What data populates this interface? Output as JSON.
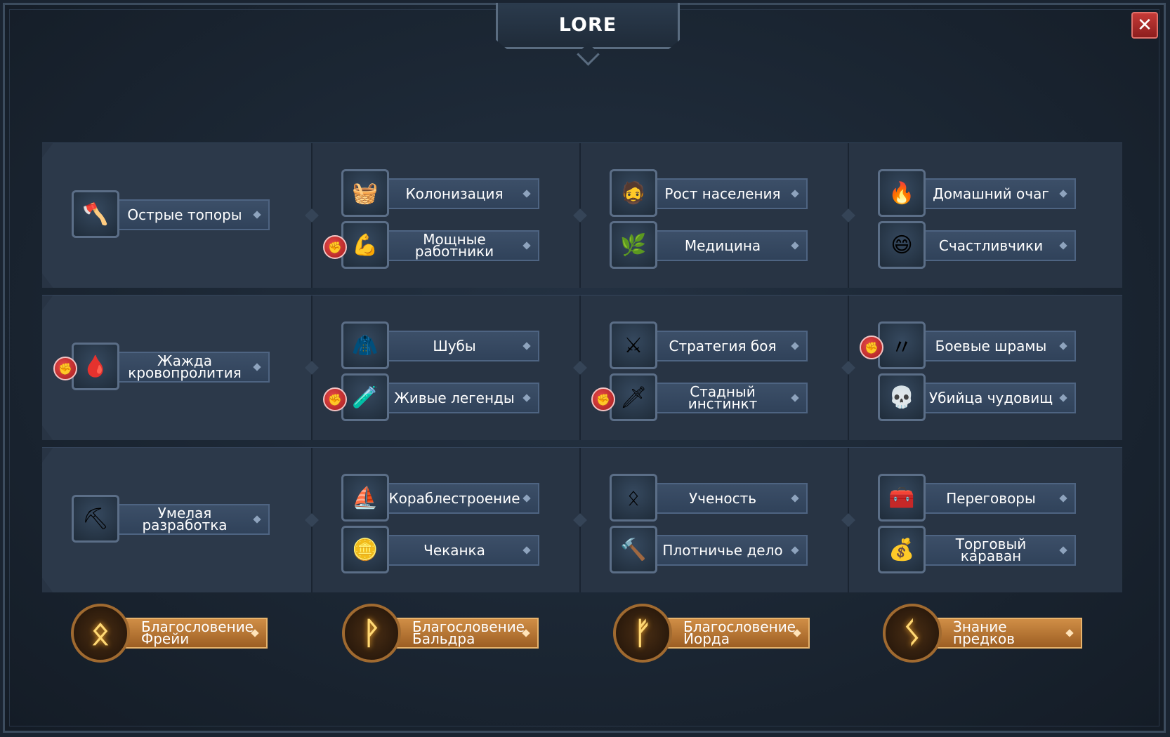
{
  "window": {
    "title": "LORE",
    "close_label": "✕"
  },
  "rows": [
    {
      "first": {
        "label": "Острые топоры",
        "icon": "axe-icon",
        "glyph": "🪓",
        "badge": false
      },
      "columns": [
        [
          {
            "label": "Колонизация",
            "icon": "food-basket-icon",
            "glyph": "🧺",
            "badge": false
          },
          {
            "label": "Мощные работники",
            "icon": "worker-icon",
            "glyph": "💪",
            "badge": true
          }
        ],
        [
          {
            "label": "Рост населения",
            "icon": "villager-icon",
            "glyph": "🧔",
            "badge": false
          },
          {
            "label": "Медицина",
            "icon": "herb-icon",
            "glyph": "🌿",
            "badge": false
          }
        ],
        [
          {
            "label": "Домашний очаг",
            "icon": "fire-icon",
            "glyph": "🔥",
            "badge": false
          },
          {
            "label": "Счастливчики",
            "icon": "lucky-viking-icon",
            "glyph": "😄",
            "badge": false
          }
        ]
      ]
    },
    {
      "first": {
        "label": "Жажда кровопролития",
        "icon": "bloody-axe-icon",
        "glyph": "🩸",
        "badge": true
      },
      "columns": [
        [
          {
            "label": "Шубы",
            "icon": "fur-icon",
            "glyph": "🧥",
            "badge": false
          },
          {
            "label": "Живые легенды",
            "icon": "potion-icon",
            "glyph": "🧪",
            "badge": true
          }
        ],
        [
          {
            "label": "Стратегия боя",
            "icon": "sword-icon",
            "glyph": "⚔",
            "badge": false
          },
          {
            "label": "Стадный инстинкт",
            "icon": "spear-icon",
            "glyph": "🗡",
            "badge": true
          }
        ],
        [
          {
            "label": "Боевые шрамы",
            "icon": "claw-marks-icon",
            "glyph": "〃",
            "badge": true
          },
          {
            "label": "Убийца чудовищ",
            "icon": "skull-icon",
            "glyph": "💀",
            "badge": false
          }
        ]
      ]
    },
    {
      "first": {
        "label": "Умелая разработка",
        "icon": "pickaxe-icon",
        "glyph": "⛏",
        "badge": false
      },
      "columns": [
        [
          {
            "label": "Кораблестроение",
            "icon": "ship-icon",
            "glyph": "⛵",
            "badge": false
          },
          {
            "label": "Чеканка",
            "icon": "coin-icon",
            "glyph": "🪙",
            "badge": false
          }
        ],
        [
          {
            "label": "Ученость",
            "icon": "runestone-icon",
            "glyph": "ᛟ",
            "badge": false
          },
          {
            "label": "Плотничье дело",
            "icon": "hammer-icon",
            "glyph": "🔨",
            "badge": false
          }
        ],
        [
          {
            "label": "Переговоры",
            "icon": "chest-icon",
            "glyph": "🧰",
            "badge": false
          },
          {
            "label": "Торговый караван",
            "icon": "trade-coins-icon",
            "glyph": "💰",
            "badge": false
          }
        ]
      ]
    }
  ],
  "blessings": [
    {
      "label": "Благословение Фрейи",
      "icon": "rune-othala-icon",
      "glyph": "ᛟ"
    },
    {
      "label": "Благословение Бальдра",
      "icon": "rune-wunjo-icon",
      "glyph": "ᚹ"
    },
    {
      "label": "Благословение Йорда",
      "icon": "rune-fehu-icon",
      "glyph": "ᚠ"
    },
    {
      "label": "Знание предков",
      "icon": "rune-sowilo-icon",
      "glyph": "ᛊ"
    }
  ],
  "badge_glyph": "✊"
}
